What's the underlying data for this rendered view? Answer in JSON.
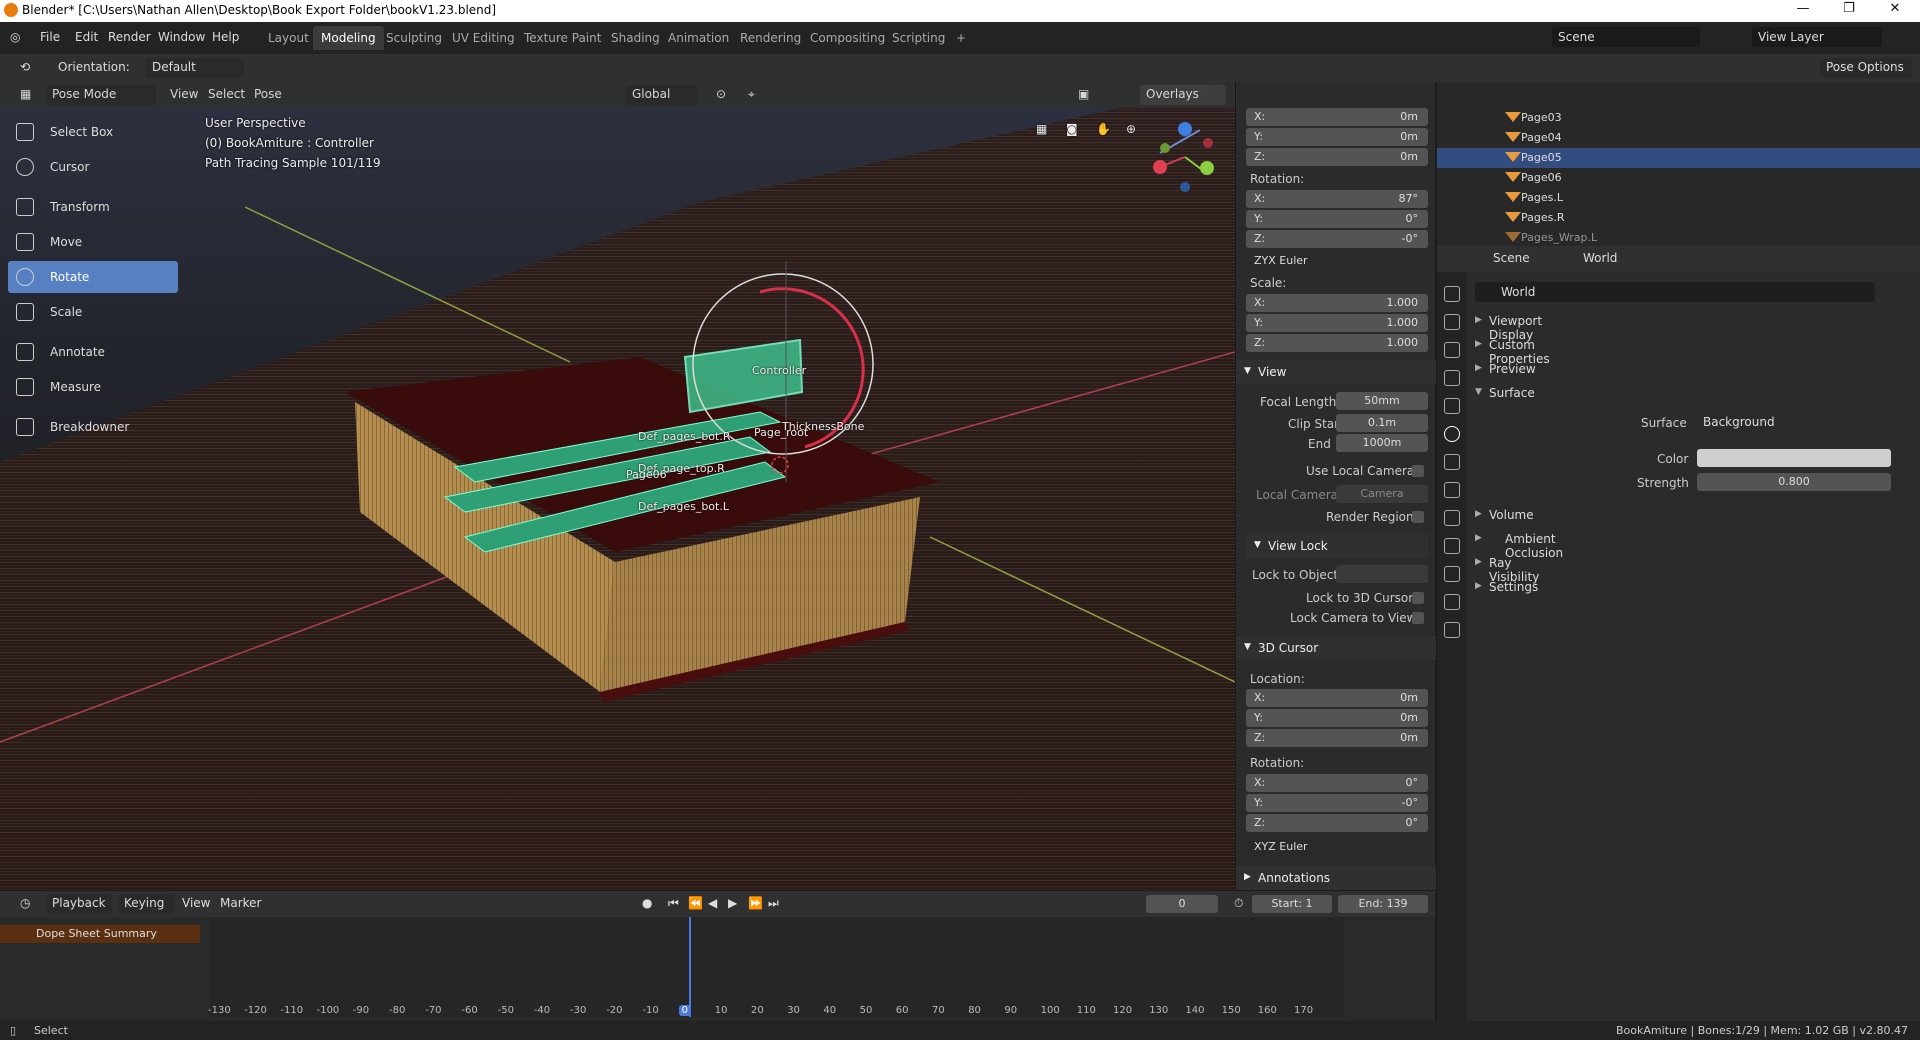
{
  "window": {
    "title": "Blender* [C:\\Users\\Nathan Allen\\Desktop\\Book Export Folder\\bookV1.23.blend]"
  },
  "menus": [
    "File",
    "Edit",
    "Render",
    "Window",
    "Help"
  ],
  "workspaces": [
    "Layout",
    "Modeling",
    "Sculpting",
    "UV Editing",
    "Texture Paint",
    "Shading",
    "Animation",
    "Rendering",
    "Compositing",
    "Scripting",
    "+"
  ],
  "scene": {
    "name": "Scene",
    "view_layer": "View Layer"
  },
  "header": {
    "orientation_label": "Orientation:",
    "orientation_value": "Default",
    "pose_options": "Pose Options"
  },
  "viewport_header": {
    "mode": "Pose Mode",
    "view": "View",
    "select": "Select",
    "pose": "Pose",
    "transform": "Global",
    "overlays": "Overlays",
    "shading": "Shading"
  },
  "tools": [
    "Select Box",
    "Cursor",
    "Transform",
    "Move",
    "Rotate",
    "Scale",
    "Annotate",
    "Measure",
    "Breakdowner"
  ],
  "viewport_info": {
    "perspective": "User Perspective",
    "object": "(0) BookAmiture : Controller",
    "render": "Path Tracing Sample 101/119"
  },
  "bone_labels": {
    "controller": "Controller",
    "thickness": "ThicknessBone",
    "page_root": "Page_root",
    "def_bot_r": "Def_pages_bot.R",
    "def_top_r": "Def_page_top.R",
    "page06": "Page06",
    "def_bot_l": "Def_pages_bot.L"
  },
  "npanel": {
    "loc": {
      "x": "0m",
      "y": "0m",
      "z": "0m"
    },
    "rotation_label": "Rotation:",
    "rot": {
      "x": "87°",
      "y": "0°",
      "z": "-0°"
    },
    "rot_mode": "ZYX Euler",
    "scale_label": "Scale:",
    "scale": {
      "x": "1.000",
      "y": "1.000",
      "z": "1.000"
    },
    "view_title": "View",
    "focal_length_label": "Focal Length",
    "focal_length": "50mm",
    "clip_start_label": "Clip Start",
    "clip_start": "0.1m",
    "end_label": "End",
    "clip_end": "1000m",
    "use_local_camera": "Use Local Camera",
    "local_camera_label": "Local Camera",
    "local_camera_placeholder": "Camera",
    "render_region": "Render Region",
    "view_lock_title": "View Lock",
    "lock_to_object": "Lock to Object",
    "lock_to_3d_cursor": "Lock to 3D Cursor",
    "lock_camera_to_view": "Lock Camera to View",
    "cursor_title": "3D Cursor",
    "location_label": "Location:",
    "cursor_loc": {
      "x": "0m",
      "y": "0m",
      "z": "0m"
    },
    "cursor_rot_label": "Rotation:",
    "cursor_rot": {
      "x": "0°",
      "y": "-0°",
      "z": "0°"
    },
    "cursor_rot_mode": "XYZ Euler",
    "annotations_title": "Annotations"
  },
  "outliner": {
    "rows": [
      "Page03",
      "Page04",
      "Page05",
      "Page06",
      "Pages.L",
      "Pages.R",
      "Pages_Wrap.L"
    ],
    "selected": "Page05"
  },
  "properties": {
    "scene": "Scene",
    "world_tab": "World",
    "world_name": "World",
    "sections": [
      "Viewport Display",
      "Custom Properties",
      "Preview",
      "Surface"
    ],
    "surface_label": "Surface",
    "surface_value": "Background",
    "color_label": "Color",
    "strength_label": "Strength",
    "strength_value": "0.800",
    "more_sections": [
      "Volume",
      "Ambient Occlusion",
      "Ray Visibility",
      "Settings"
    ]
  },
  "timeline": {
    "playback": "Playback",
    "keying": "Keying",
    "view": "View",
    "marker": "Marker",
    "current_frame": "0",
    "start_label": "Start:",
    "start": "1",
    "end_label": "End:",
    "end": "139",
    "summary": "Dope Sheet Summary",
    "ticks": [
      "-130",
      "-120",
      "-110",
      "-100",
      "-90",
      "-80",
      "-70",
      "-60",
      "-50",
      "-40",
      "-30",
      "-20",
      "-10",
      "0",
      "10",
      "20",
      "30",
      "40",
      "50",
      "60",
      "70",
      "80",
      "90",
      "100",
      "110",
      "120",
      "130",
      "140",
      "150",
      "160",
      "170"
    ]
  },
  "status": {
    "select": "Select",
    "info": "BookAmiture | Bones:1/29 | Mem: 1.02 GB | v2.80.47"
  },
  "colors": {
    "accent": "#5680c2",
    "selected_row": "#334d80",
    "book_cover": "#4a0d0d",
    "pages": "#b58e4f",
    "bone_green": "#3fbf8c"
  }
}
